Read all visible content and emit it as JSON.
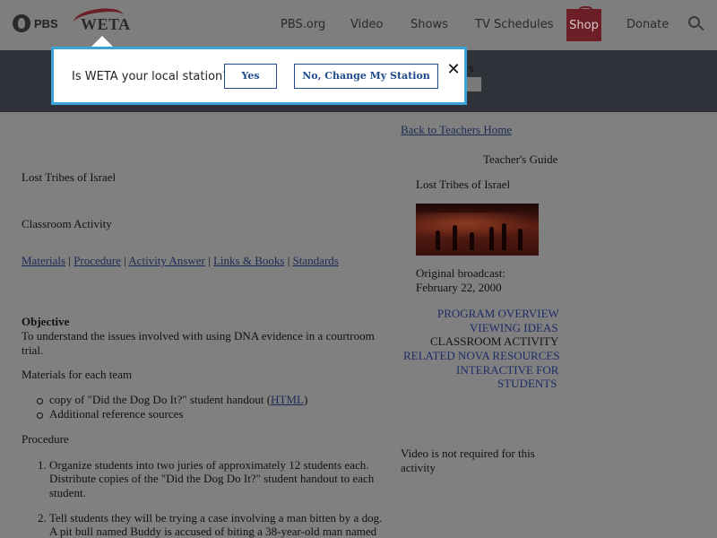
{
  "header": {
    "pbs_logo": "PBS",
    "weta_logo": "WETA",
    "nav": [
      "PBS.org",
      "Video",
      "Shows",
      "TV Schedules",
      "Shop",
      "Donate"
    ]
  },
  "band": {
    "text": "rs"
  },
  "popup": {
    "question": "Is WETA your local station?",
    "yes_label": "Yes",
    "change_label": "No, Change My Station",
    "close_label": "✕"
  },
  "left": {
    "title": "Lost Tribes of Israel",
    "subtitle": "Classroom Activity",
    "links": [
      "Materials",
      "Procedure",
      "Activity Answer",
      "Links & Books",
      "Standards"
    ],
    "separator": " | ",
    "objective_heading": "Objective",
    "objective_line1": "To understand the issues involved with using DNA evidence in a courtroom",
    "objective_line2": "trial.",
    "materials_heading": "Materials for each team",
    "bullet1_prefix": "copy of \"Did the Dog Do It?\" student handout (",
    "bullet1_link": "HTML",
    "bullet1_suffix": ")",
    "bullet2": "Additional reference sources",
    "procedure_heading": "Procedure",
    "step1_line1": "Organize students into two juries of approximately 12 students each.",
    "step1_line2": "Distribute copies of the \"Did the Dog Do It?\" student handout to each",
    "step1_line3": "student.",
    "step2_line1": "Tell students they will be trying a case involving a man bitten by a dog.",
    "step2_line2": "A pit bull named Buddy is accused of biting a 38-year-old man named"
  },
  "right": {
    "back_link": "Back to Teachers Home",
    "guide_label": "Teacher's Guide",
    "program_title": "Lost Tribes of Israel",
    "broadcast_label": "Original broadcast:",
    "broadcast_date": "February 22, 2000",
    "nav_program_overview": "PROGRAM OVERVIEW",
    "nav_viewing_ideas": "VIEWING IDEAS",
    "nav_classroom_activity": "CLASSROOM ACTIVITY",
    "nav_related": "RELATED NOVA RESOURCES",
    "nav_interactive_1": "INTERACTIVE FOR",
    "nav_interactive_2": "STUDENTS",
    "video_note_line1": "Video is not required for this",
    "video_note_line2": "activity"
  }
}
